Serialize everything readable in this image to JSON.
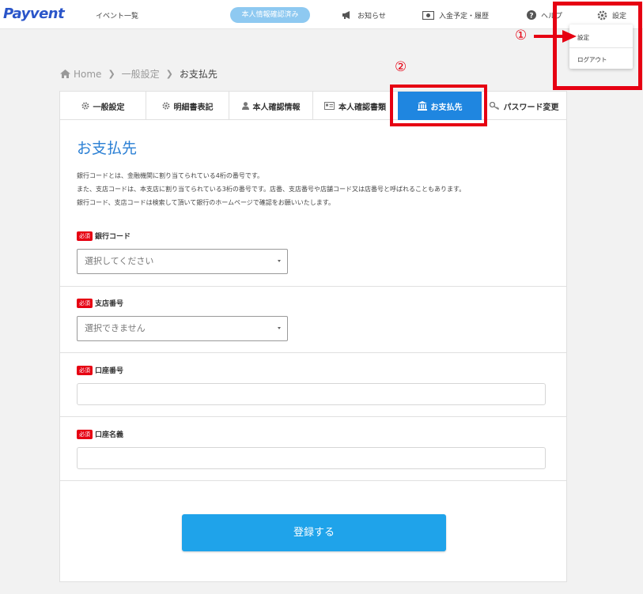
{
  "header": {
    "logo": "Payvent",
    "nav_list": "イベント一覧",
    "verified_badge": "本人情報確認済み",
    "news": "お知らせ",
    "deposits": "入金予定・履歴",
    "help": "ヘルプ",
    "settings": "設定"
  },
  "dropdown": {
    "item_settings": "設定",
    "item_logout": "ログアウト"
  },
  "annotations": {
    "num1": "①",
    "num2": "②"
  },
  "breadcrumb": {
    "home": "Home",
    "general": "一般設定",
    "current": "お支払先"
  },
  "tabs": [
    {
      "label": "一般設定",
      "icon": "gear-icon"
    },
    {
      "label": "明細書表記",
      "icon": "gear-icon"
    },
    {
      "label": "本人確認情報",
      "icon": "user-icon"
    },
    {
      "label": "本人確認書類",
      "icon": "id-card-icon"
    },
    {
      "label": "お支払先",
      "icon": "bank-icon"
    },
    {
      "label": "パスワード変更",
      "icon": "key-icon"
    }
  ],
  "page": {
    "title": "お支払先",
    "desc1": "銀行コードとは、金融機関に割り当てられている4桁の番号です。",
    "desc2": "また、支店コードは、本支店に割り当てられている3桁の番号です。店番、支店番号や店舗コード又は店番号と呼ばれることもあります。",
    "desc3": "銀行コード、支店コードは検索して頂いて銀行のホームページで確認をお願いいたします。"
  },
  "form": {
    "required_badge": "必須",
    "bank_code_label": "銀行コード",
    "bank_code_value": "選択してください",
    "branch_label": "支店番号",
    "branch_value": "選択できません",
    "account_number_label": "口座番号",
    "account_name_label": "口座名義",
    "submit": "登録する"
  },
  "colors": {
    "brand": "#2a55c9",
    "accent": "#1f86e0",
    "required": "#e60012",
    "annotation": "#e60012"
  }
}
